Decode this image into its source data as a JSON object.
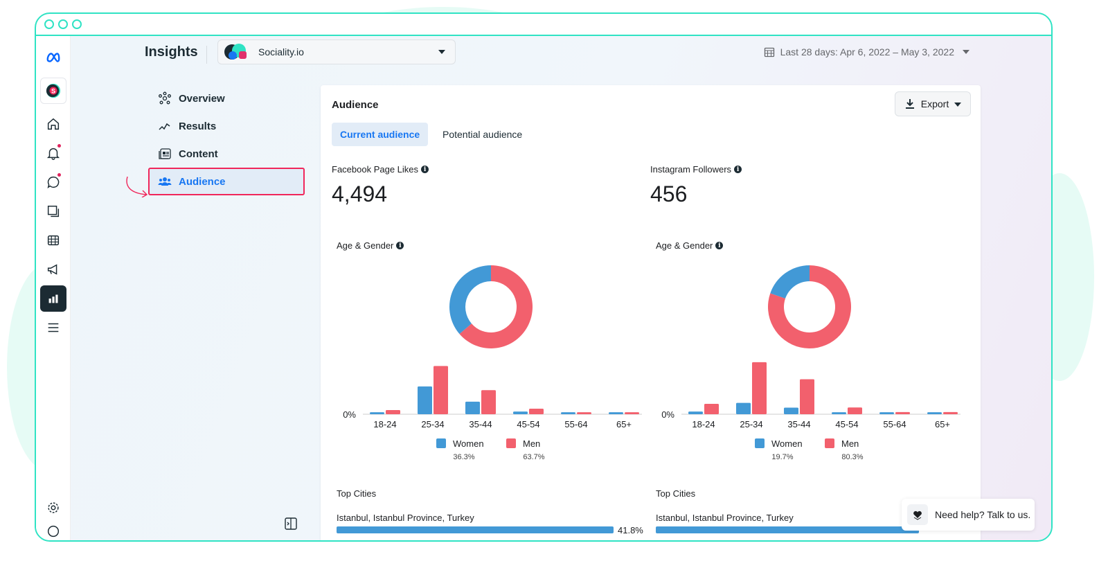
{
  "colors": {
    "women": "#4299d6",
    "men": "#f2606d",
    "accent": "#1877f2",
    "frame": "#2fe3c4",
    "highlight": "#f0265a"
  },
  "header": {
    "title": "Insights",
    "account": "Sociality.io",
    "date_range": "Last 28 days: Apr 6, 2022 – May 3, 2022"
  },
  "rail": {
    "icons": [
      "meta-logo-icon",
      "sociality-avatar",
      "home-icon",
      "notifications-icon",
      "messages-icon",
      "pages-icon",
      "table-icon",
      "ads-megaphone-icon",
      "insights-chart-icon",
      "menu-icon",
      "settings-icon",
      "help-icon"
    ]
  },
  "nav": {
    "items": [
      {
        "label": "Overview",
        "icon": "overview-icon"
      },
      {
        "label": "Results",
        "icon": "results-icon"
      },
      {
        "label": "Content",
        "icon": "content-icon"
      },
      {
        "label": "Audience",
        "icon": "audience-icon",
        "active": true
      }
    ]
  },
  "card": {
    "title": "Audience",
    "export_label": "Export",
    "tabs": [
      {
        "label": "Current audience",
        "active": true
      },
      {
        "label": "Potential audience"
      }
    ]
  },
  "metrics": [
    {
      "label": "Facebook Page Likes",
      "value": "4,494"
    },
    {
      "label": "Instagram Followers",
      "value": "456"
    }
  ],
  "chart_data": [
    {
      "type": "bar",
      "title": "Age & Gender",
      "platform": "Facebook",
      "categories": [
        "18-24",
        "25-34",
        "35-44",
        "45-54",
        "55-64",
        "65+"
      ],
      "y_tick": "0%",
      "series": [
        {
          "name": "Women",
          "total": "36.3%",
          "values": [
            1.5,
            20.6,
            9.3,
            2.0,
            1.5,
            1.5
          ]
        },
        {
          "name": "Men",
          "total": "63.7%",
          "values": [
            3.1,
            35.7,
            17.8,
            4.1,
            1.5,
            1.5
          ]
        }
      ],
      "donut": {
        "women": 36.3,
        "men": 63.7
      }
    },
    {
      "type": "bar",
      "title": "Age & Gender",
      "platform": "Instagram",
      "categories": [
        "18-24",
        "25-34",
        "35-44",
        "45-54",
        "55-64",
        "65+"
      ],
      "y_tick": "0%",
      "series": [
        {
          "name": "Women",
          "total": "19.7%",
          "values": [
            2.0,
            8.4,
            4.9,
            1.5,
            1.5,
            1.5
          ]
        },
        {
          "name": "Men",
          "total": "80.3%",
          "values": [
            7.7,
            38.5,
            25.9,
            5.0,
            1.6,
            1.6
          ]
        }
      ],
      "donut": {
        "women": 19.7,
        "men": 80.3
      }
    }
  ],
  "top_cities": [
    {
      "title": "Top Cities",
      "city": "Istanbul, Istanbul Province, Turkey",
      "percent": 41.8,
      "percent_label": "41.8%"
    },
    {
      "title": "Top Cities",
      "city": "Istanbul, Istanbul Province, Turkey"
    }
  ],
  "help": {
    "label": "Need help? Talk to us."
  }
}
